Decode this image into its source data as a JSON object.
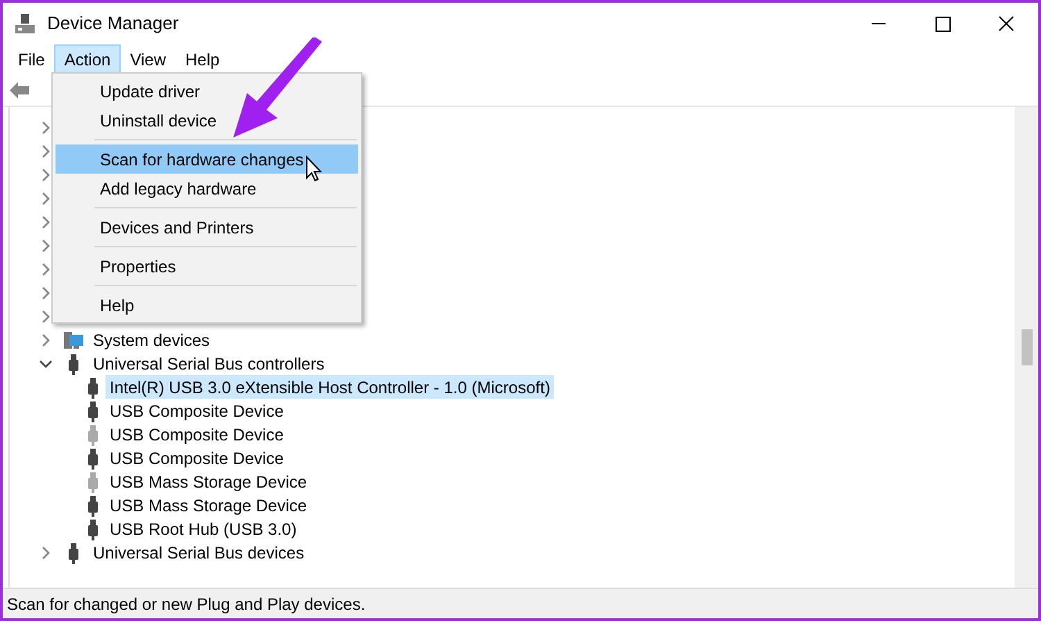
{
  "window": {
    "title": "Device Manager"
  },
  "menu_bar": [
    {
      "label": "File",
      "selected": false
    },
    {
      "label": "Action",
      "selected": true
    },
    {
      "label": "View",
      "selected": false
    },
    {
      "label": "Help",
      "selected": false
    }
  ],
  "action_menu": [
    {
      "kind": "item",
      "label": "Update driver",
      "selected": false
    },
    {
      "kind": "item",
      "label": "Uninstall device",
      "selected": false
    },
    {
      "kind": "separator"
    },
    {
      "kind": "item",
      "label": "Scan for hardware changes",
      "selected": true
    },
    {
      "kind": "item",
      "label": "Add legacy hardware",
      "selected": false
    },
    {
      "kind": "separator"
    },
    {
      "kind": "item",
      "label": "Devices and Printers",
      "selected": false
    },
    {
      "kind": "separator"
    },
    {
      "kind": "item",
      "label": "Properties",
      "selected": false
    },
    {
      "kind": "separator"
    },
    {
      "kind": "item",
      "label": "Help",
      "selected": false
    }
  ],
  "tree": [
    {
      "expanded": false
    },
    {
      "expanded": false
    },
    {
      "expanded": false
    },
    {
      "expanded": false
    },
    {
      "expanded": false
    },
    {
      "expanded": false
    },
    {
      "expanded": false
    },
    {
      "expanded": false
    },
    {
      "expanded": false
    },
    {
      "label": "System devices",
      "kind": "monitor",
      "expanded": false
    },
    {
      "label": "Universal Serial Bus controllers",
      "kind": "usb",
      "expanded": true,
      "children": [
        {
          "label": "Intel(R) USB 3.0 eXtensible Host Controller - 1.0 (Microsoft)",
          "selected": true,
          "disabled": false
        },
        {
          "label": "USB Composite Device",
          "selected": false,
          "disabled": false
        },
        {
          "label": "USB Composite Device",
          "selected": false,
          "disabled": true
        },
        {
          "label": "USB Composite Device",
          "selected": false,
          "disabled": false
        },
        {
          "label": "USB Mass Storage Device",
          "selected": false,
          "disabled": true
        },
        {
          "label": "USB Mass Storage Device",
          "selected": false,
          "disabled": false
        },
        {
          "label": "USB Root Hub (USB 3.0)",
          "selected": false,
          "disabled": false
        }
      ]
    },
    {
      "label": "Universal Serial Bus devices",
      "kind": "usb",
      "expanded": false
    }
  ],
  "status_bar": "Scan for changed or new Plug and Play devices."
}
